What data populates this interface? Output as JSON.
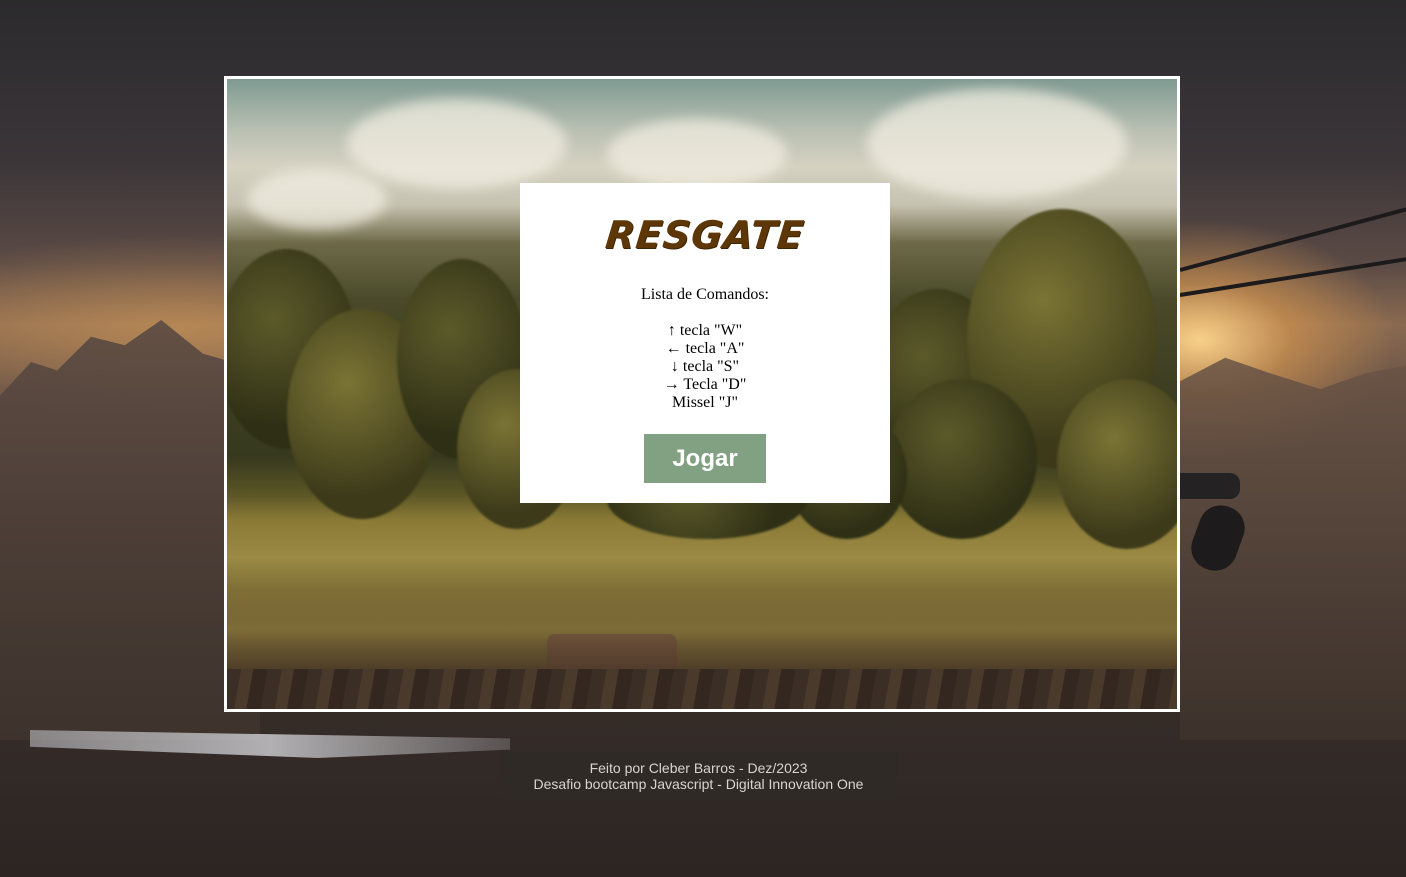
{
  "game": {
    "title": "RESGATE",
    "commands_heading": "Lista de Comandos:",
    "commands": [
      {
        "key": "↑",
        "label": "tecla \"W\""
      },
      {
        "key": "←",
        "label": "tecla \"A\""
      },
      {
        "key": "↓",
        "label": "tecla \"S\""
      },
      {
        "key": "→",
        "label": "Tecla \"D\""
      },
      {
        "key": "",
        "label": "Missel \"J\""
      }
    ],
    "play_label": "Jogar"
  },
  "footer": {
    "credit_line": "Feito por Cleber Barros - Dez/2023",
    "project_line": "Desafio bootcamp Javascript - Digital Innovation One"
  },
  "colors": {
    "title": "#5e3708",
    "play_button": "#82a182",
    "board_border": "#ffffff",
    "panel": "#ffffff"
  }
}
